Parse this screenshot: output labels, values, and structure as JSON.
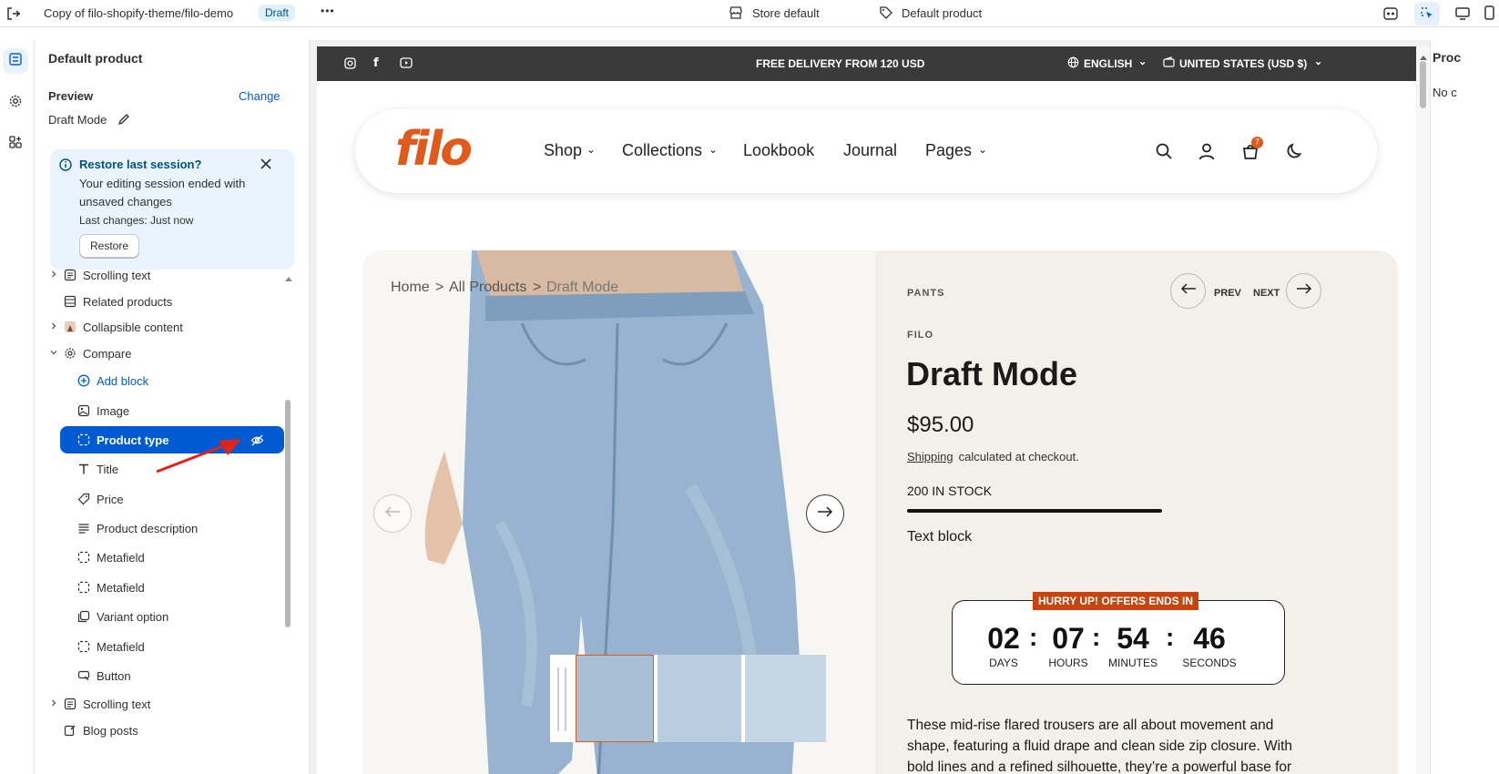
{
  "topbar": {
    "doc_title": "Copy of filo-shopify-theme/filo-demo",
    "status_badge": "Draft",
    "more_label": "•••",
    "store_label": "Store default",
    "template_label": "Default product"
  },
  "sidebar": {
    "title": "Default product",
    "preview_label": "Preview",
    "change_label": "Change",
    "preview_value": "Draft Mode",
    "restore": {
      "title": "Restore last session?",
      "line1": "Your editing session ended with",
      "line2": "unsaved changes",
      "last_changes": "Last changes: Just now",
      "button": "Restore"
    },
    "items": [
      {
        "label": "Scrolling text",
        "icon": "text-block-icon",
        "expand": true
      },
      {
        "label": "Related products",
        "icon": "list-icon",
        "expand": false
      },
      {
        "label": "Collapsible content",
        "icon": "image-section-icon",
        "expand": true
      },
      {
        "label": "Compare",
        "icon": "gear-icon",
        "expand": true,
        "open": true
      },
      {
        "label": "Add block",
        "icon": "plus-circle-icon",
        "child": true,
        "add": true
      },
      {
        "label": "Image",
        "icon": "image-icon",
        "child": true
      },
      {
        "label": "Product type",
        "icon": "dashed-square-icon",
        "child": true,
        "selected": true
      },
      {
        "label": "Title",
        "icon": "title-icon",
        "child": true
      },
      {
        "label": "Price",
        "icon": "price-tag-icon",
        "child": true
      },
      {
        "label": "Product description",
        "icon": "paragraph-icon",
        "child": true
      },
      {
        "label": "Metafield",
        "icon": "dashed-square-icon",
        "child": true
      },
      {
        "label": "Metafield",
        "icon": "dashed-square-icon",
        "child": true
      },
      {
        "label": "Variant option",
        "icon": "variant-icon",
        "child": true
      },
      {
        "label": "Metafield",
        "icon": "dashed-square-icon",
        "child": true
      },
      {
        "label": "Button",
        "icon": "button-icon",
        "child": true
      },
      {
        "label": "Scrolling text",
        "icon": "text-block-icon",
        "expand": true
      },
      {
        "label": "Blog posts",
        "icon": "blog-icon",
        "expand": false
      }
    ]
  },
  "store": {
    "announcement": "FREE DELIVERY FROM 120 USD",
    "language": "ENGLISH",
    "currency": "UNITED STATES (USD $)",
    "logo": "filo",
    "nav": [
      "Shop",
      "Collections",
      "Lookbook",
      "Journal",
      "Pages"
    ],
    "cart_count": "7",
    "breadcrumb": [
      "Home",
      ">",
      "All Products",
      ">",
      "Draft Mode"
    ],
    "product": {
      "type": "PANTS",
      "vendor": "FILO",
      "title": "Draft Mode",
      "price": "$95.00",
      "shipping_link": "Shipping",
      "shipping_note": " calculated at checkout.",
      "stock": "200 IN STOCK",
      "stock_fill": 1.0,
      "text_block": "Text block",
      "prev": "PREV",
      "next": "NEXT",
      "countdown_banner": "HURRY UP! OFFERS ENDS IN",
      "countdown": {
        "days": "02",
        "hours": "07",
        "minutes": "54",
        "seconds": "46",
        "days_label": "DAYS",
        "hours_label": "HOURS",
        "minutes_label": "MINUTES",
        "seconds_label": "SECONDS"
      },
      "description_1": "These mid-rise flared trousers are all about movement and",
      "description_2": "shape, featuring a fluid drape and clean side zip closure. With",
      "description_3": "bold lines and a refined silhouette, they’re a powerful base for"
    }
  },
  "right_panel": {
    "title": "Proc",
    "body": "No c"
  },
  "colors": {
    "accent": "#005bd3",
    "logo": "#e05a1b",
    "countdown_banner": "#c8440e",
    "announcement_bg": "#3a3a3a"
  }
}
